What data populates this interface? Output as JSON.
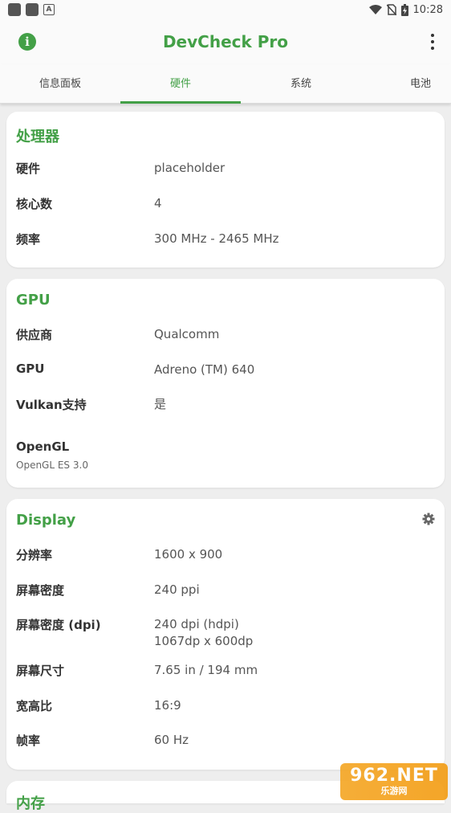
{
  "status_bar": {
    "time": "10:28"
  },
  "app_bar": {
    "title": "DevCheck Pro"
  },
  "tabs": [
    {
      "label": "信息面板"
    },
    {
      "label": "硬件"
    },
    {
      "label": "系统"
    },
    {
      "label": "电池"
    }
  ],
  "processor": {
    "title": "处理器",
    "rows": [
      {
        "label": "硬件",
        "value": " placeholder"
      },
      {
        "label": "核心数",
        "value": "4"
      },
      {
        "label": "频率",
        "value": "300 MHz - 2465 MHz"
      }
    ]
  },
  "gpu": {
    "title": "GPU",
    "rows": [
      {
        "label": "供应商",
        "value": "Qualcomm"
      },
      {
        "label": "GPU",
        "value": "Adreno (TM) 640"
      },
      {
        "label": "Vulkan支持",
        "value": "是"
      }
    ],
    "opengl_label": "OpenGL",
    "opengl_value": "OpenGL ES 3.0"
  },
  "display": {
    "title": "Display",
    "rows": [
      {
        "label": "分辨率",
        "value": "1600 x 900"
      },
      {
        "label": "屏幕密度",
        "value": "240 ppi"
      },
      {
        "label": "屏幕密度 (dpi)",
        "value": "240 dpi (hdpi)",
        "value2": "1067dp x 600dp"
      },
      {
        "label": "屏幕尺寸",
        "value": "7.65 in / 194 mm"
      },
      {
        "label": "宽高比",
        "value": "16:9"
      },
      {
        "label": "帧率",
        "value": "60 Hz"
      }
    ]
  },
  "memory": {
    "title": "内存"
  },
  "watermark": {
    "main": "962.NET",
    "sub": "乐游网"
  },
  "colors": {
    "accent": "#43a047"
  }
}
